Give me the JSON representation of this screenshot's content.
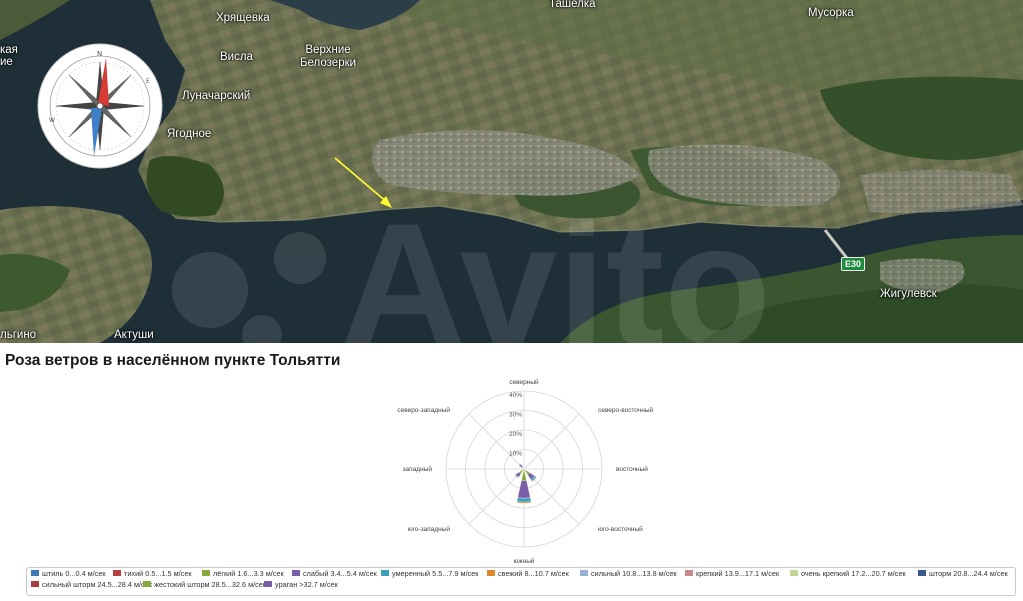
{
  "map": {
    "places": [
      {
        "name": "Хрящевка"
      },
      {
        "name": "Ташелка"
      },
      {
        "name": "Мусорка"
      },
      {
        "name": "Верхние\nБелозерки"
      },
      {
        "name": "Висла"
      },
      {
        "name": "Луначарский"
      },
      {
        "name": "Ягодное"
      },
      {
        "name": "Жигулевск"
      },
      {
        "name": "Актуши"
      },
      {
        "name": "льгино"
      },
      {
        "name": "кая"
      },
      {
        "name": "ие"
      }
    ],
    "road_shield": "E30",
    "watermark": "Avito",
    "colors": {
      "water": "#1f3038",
      "land": "#5b6a47",
      "arrow": "#ffff33"
    }
  },
  "wind_rose": {
    "title": "Роза ветров в населённом пункте Тольятти",
    "directions": [
      "северный",
      "северо-восточный",
      "восточный",
      "юго-восточный",
      "южный",
      "юго-западный",
      "западный",
      "северо-западный"
    ],
    "ring_labels": [
      "10%",
      "20%",
      "30%",
      "40%"
    ],
    "legend": [
      {
        "label": "штиль 0...0.4 м/сек",
        "color": "#3c78b4"
      },
      {
        "label": "тихий 0.5...1.5 м/сек",
        "color": "#b84040"
      },
      {
        "label": "лёгкий 1.6...3.3 м/сек",
        "color": "#8aa83c"
      },
      {
        "label": "слабый 3.4...5.4 м/сек",
        "color": "#7a5ea8"
      },
      {
        "label": "умеренный 5.5...7.9 м/сек",
        "color": "#3aa0b8"
      },
      {
        "label": "свежий 8...10.7 м/сек",
        "color": "#e0882c"
      },
      {
        "label": "сильный 10.8...13.8 м/сек",
        "color": "#9cb0d4"
      },
      {
        "label": "крепкий 13.9...17.1 м/сек",
        "color": "#c88a8a"
      },
      {
        "label": "очень крепкий 17.2...20.7 м/сек",
        "color": "#c2d69a"
      },
      {
        "label": "шторм 20.8...24.4 м/сек",
        "color": "#3a5a8c"
      },
      {
        "label": "сильный шторм 24.5...28.4 м/сек",
        "color": "#a83c3c"
      },
      {
        "label": "жестокий шторм 28.5...32.6 м/сек",
        "color": "#8aa83c"
      },
      {
        "label": "ураган >32.7 м/сек",
        "color": "#7a5ea8"
      }
    ]
  },
  "chart_data": {
    "type": "polar-stacked-bar",
    "title": "Роза ветров в населённом пункте Тольятти",
    "directions": [
      "северный",
      "северо-восточный",
      "восточный",
      "юго-восточный",
      "южный",
      "юго-западный",
      "западный",
      "северо-западный"
    ],
    "r_ticks": [
      "10%",
      "20%",
      "30%",
      "40%"
    ],
    "r_max": 40,
    "series": [
      {
        "name": "штиль 0...0.4 м/сек",
        "values": [
          0,
          0,
          0,
          0,
          0,
          0,
          0,
          0
        ]
      },
      {
        "name": "тихий 0.5...1.5 м/сек",
        "values": [
          0.3,
          0.3,
          0.2,
          1.0,
          1.5,
          1.0,
          0.4,
          0.3
        ]
      },
      {
        "name": "лёгкий 1.6...3.3 м/сек",
        "values": [
          0.5,
          0.4,
          0.2,
          2.5,
          4.5,
          2.0,
          0.6,
          1.0
        ]
      },
      {
        "name": "слабый 3.4...5.4 м/сек",
        "values": [
          0.4,
          0.3,
          0.1,
          3.0,
          9.0,
          2.0,
          0.4,
          1.5
        ]
      },
      {
        "name": "умеренный 5.5...7.9 м/сек",
        "values": [
          0.2,
          0.1,
          0,
          1.0,
          2.0,
          0.5,
          0.2,
          0.5
        ]
      },
      {
        "name": "свежий 8...10.7 м/сек",
        "values": [
          0.1,
          0,
          0,
          0.3,
          0.6,
          0.2,
          0.1,
          0.1
        ]
      },
      {
        "name": "сильный 10.8...13.8 м/сек",
        "values": [
          0,
          0,
          0,
          0,
          0,
          0,
          0,
          0
        ]
      },
      {
        "name": "крепкий 13.9...17.1 м/сек",
        "values": [
          0,
          0,
          0,
          0,
          0,
          0,
          0,
          0
        ]
      },
      {
        "name": "очень крепкий 17.2...20.7 м/сек",
        "values": [
          0,
          0,
          0,
          0,
          0,
          0,
          0,
          0
        ]
      },
      {
        "name": "шторм 20.8...24.4 м/сек",
        "values": [
          0,
          0,
          0,
          0,
          0,
          0,
          0,
          0
        ]
      },
      {
        "name": "сильный шторм 24.5...28.4 м/сек",
        "values": [
          0,
          0,
          0,
          0,
          0,
          0,
          0,
          0
        ]
      },
      {
        "name": "жестокий шторм 28.5...32.6 м/сек",
        "values": [
          0,
          0,
          0,
          0,
          0,
          0,
          0,
          0
        ]
      },
      {
        "name": "ураган >32.7 м/сек",
        "values": [
          0,
          0,
          0,
          0,
          0,
          0,
          0,
          0
        ]
      }
    ]
  }
}
